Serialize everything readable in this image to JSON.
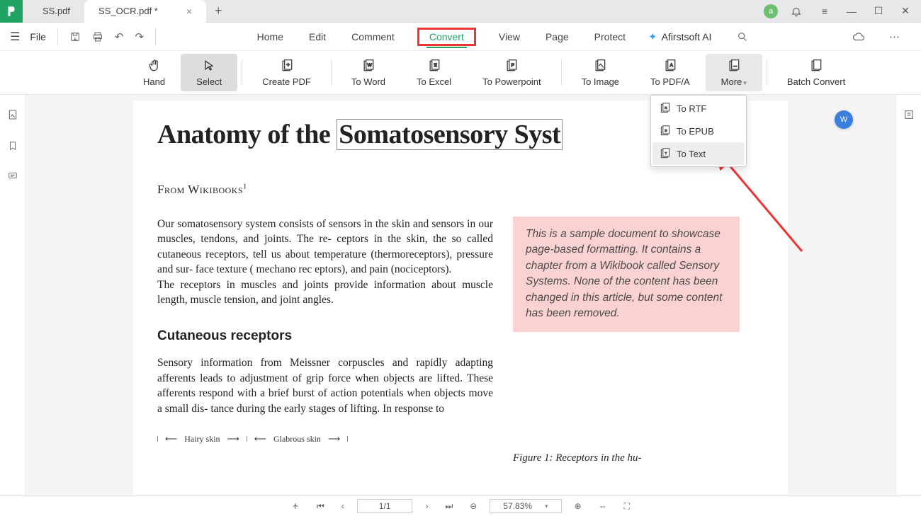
{
  "tabs": [
    {
      "label": "SS.pdf"
    },
    {
      "label": "SS_OCR.pdf *"
    }
  ],
  "avatar_initial": "a",
  "file_label": "File",
  "menu": {
    "home": "Home",
    "edit": "Edit",
    "comment": "Comment",
    "convert": "Convert",
    "view": "View",
    "page": "Page",
    "protect": "Protect",
    "ai": "Afirstsoft AI"
  },
  "ribbon": {
    "hand": "Hand",
    "select": "Select",
    "create_pdf": "Create PDF",
    "to_word": "To Word",
    "to_excel": "To Excel",
    "to_ppt": "To Powerpoint",
    "to_image": "To Image",
    "to_pdfa": "To PDF/A",
    "more": "More",
    "batch": "Batch Convert"
  },
  "more_menu": {
    "to_rtf": "To RTF",
    "to_epub": "To EPUB",
    "to_text": "To Text"
  },
  "doc": {
    "title_a": "Anatomy of the ",
    "title_b": "Somatosensory Syst",
    "from": "From Wikibooks",
    "p1": "Our somatosensory system consists of  sensors in the skin  and sensors  in  our   muscles, tendons,  and  joints.  The re-  ceptors in the skin, the so  called cutaneous receptors,   tell  us about temperature (thermoreceptors),  pressure and sur-  face  texture (  mechano rec  eptors),  and pain  (nociceptors).",
    "p1b": "The  receptors  in  muscles  and  joints  provide  information about muscle length, muscle   tension, and joint angles.",
    "callout": "This is a sample document to showcase page-based formatting. It contains a chapter from a Wikibook called Sensory Systems. None of the content has been changed in this article, but some content has been removed.",
    "subhead": "Cutaneous receptors",
    "p2": "Sensory information from Meissner corpuscles and rapidly adapting afferents leads to adjustment of grip force when objects  are  lifted.  These  afferents  respond  with  a  brief burst of action potentials when objects move a small dis- tance  during  the  early  stages  of  lifting.  In  response  to",
    "hairy": "Hairy skin",
    "glabrous": "Glabrous skin",
    "fig": "Figure  1:    Receptors  in  the  hu-"
  },
  "status": {
    "page": "1/1",
    "zoom": "57.83%"
  }
}
